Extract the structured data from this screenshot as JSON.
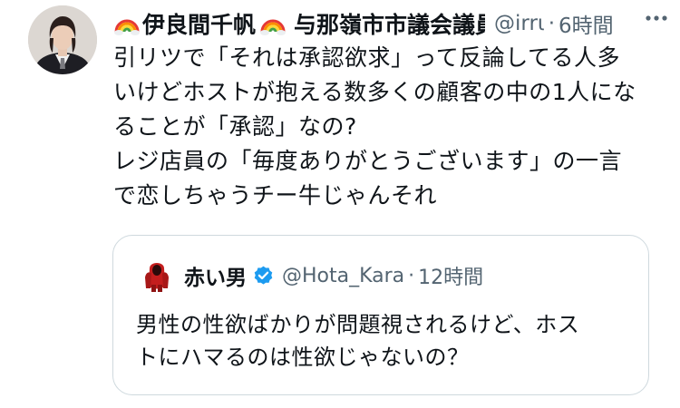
{
  "tweet": {
    "display_name": "伊良間千帆",
    "affiliation": "与那嶺市市議会議員",
    "handle": "@irrι",
    "separator": "·",
    "time": "6時間",
    "avatar_icon": "user-avatar-photo",
    "rainbow_icon": "rainbow-icon",
    "more_icon": "more-horizontal-icon",
    "text": "引リツで「それは承認欲求」って反論してる人多\nいけどホストが抱える数多くの顧客の中の1人にな\nることが「承認」なの?\nレジ店員の「毎度ありがとうございます」の一言\nで恋しちゃうチー牛じゃんそれ"
  },
  "quoted_tweet": {
    "display_name": "赤い男",
    "verified_icon": "verified-badge-icon",
    "handle": "@Hota_Kara",
    "separator": "·",
    "time": "12時間",
    "text": "男性の性欲ばかりが問題視されるけど、ホス\nトにハマるのは性欲じゃないの？"
  },
  "colors": {
    "text_primary": "#0f1419",
    "text_secondary": "#536471",
    "verified_blue": "#1d9bf0",
    "border": "#cfd9de"
  }
}
